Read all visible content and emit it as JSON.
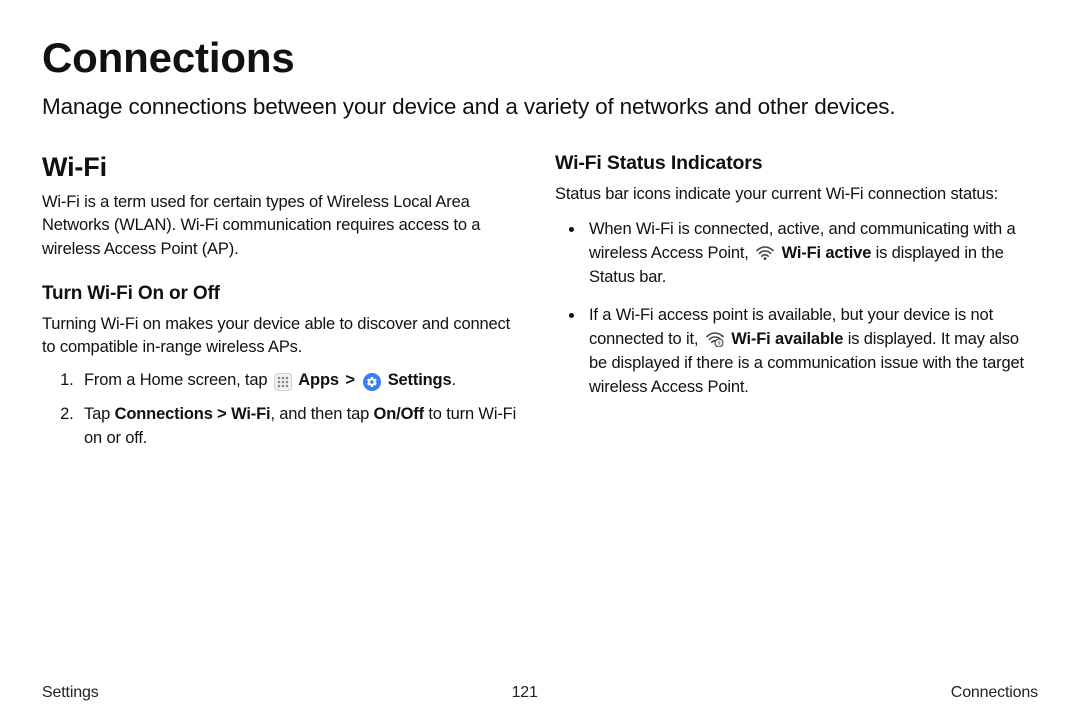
{
  "title": "Connections",
  "intro": "Manage connections between your device and a variety of networks and other devices.",
  "left": {
    "heading": "Wi-Fi",
    "desc": "Wi-Fi is a term used for certain types of Wireless Local Area Networks (WLAN). Wi-Fi communication requires access to a wireless Access Point (AP).",
    "sub1": "Turn Wi-Fi On or Off",
    "sub1_desc": "Turning Wi-Fi on makes your device able to discover and connect to compatible in-range wireless APs.",
    "step1_a": "From a Home screen, tap",
    "apps_label": "Apps",
    "sep": ">",
    "settings_label": "Settings",
    "step1_end": ".",
    "step2_a": "Tap ",
    "step2_b1": "Connections",
    "step2_sep1": " > ",
    "step2_b2": "Wi-Fi",
    "step2_mid": ", and then tap ",
    "step2_b3": "On/Off",
    "step2_end": " to turn Wi-Fi on or off."
  },
  "right": {
    "heading": "Wi-Fi Status Indicators",
    "desc": "Status bar icons indicate your current Wi-Fi connection status:",
    "b1_a": "When Wi-Fi is connected, active, and communicating with a wireless Access Point,",
    "b1_bold": "Wi-Fi active",
    "b1_b": " is displayed in the Status bar.",
    "b2_a": "If a Wi-Fi access point is available, but your device is not connected to it,",
    "b2_bold": "Wi-Fi available",
    "b2_b": " is displayed. It may also be displayed if there is a communication issue with the target wireless Access Point."
  },
  "footer": {
    "left": "Settings",
    "center": "121",
    "right": "Connections"
  }
}
